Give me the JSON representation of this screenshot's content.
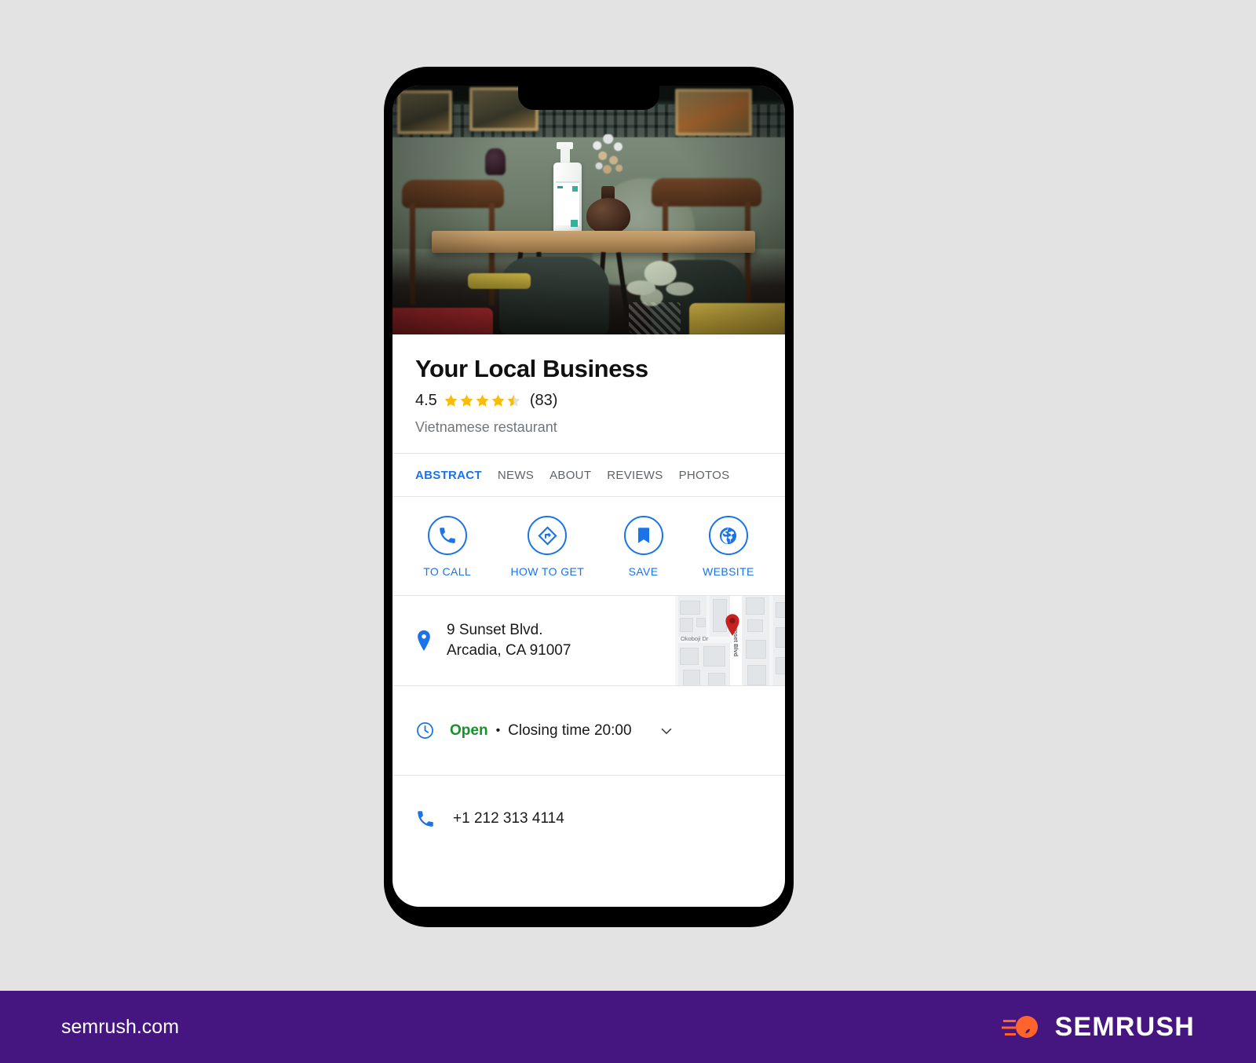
{
  "business": {
    "name": "Your Local Business",
    "rating_value": "4.5",
    "review_count": "(83)",
    "category": "Vietnamese restaurant",
    "stars_filled": 4,
    "stars_half": 1,
    "stars_total": 5,
    "star_color": "#fbbc04",
    "star_empty_color": "#e0e0e0"
  },
  "tabs": [
    {
      "label": "ABSTRACT",
      "active": true
    },
    {
      "label": "NEWS",
      "active": false
    },
    {
      "label": "ABOUT",
      "active": false
    },
    {
      "label": "REVIEWS",
      "active": false
    },
    {
      "label": "PHOTOS",
      "active": false
    }
  ],
  "actions": [
    {
      "label": "TO CALL",
      "icon": "phone-icon"
    },
    {
      "label": "HOW TO GET",
      "icon": "directions-icon"
    },
    {
      "label": "SAVE",
      "icon": "bookmark-icon"
    },
    {
      "label": "WEBSITE",
      "icon": "globe-icon"
    }
  ],
  "address": {
    "line1": "9 Sunset Blvd.",
    "line2": "Arcadia, CA 91007",
    "icon": "map-pin-icon",
    "map": {
      "street_label_1": "Okoboji Dr",
      "street_label_2": "Sunset Blvd",
      "pin_color": "#c5221f"
    }
  },
  "hours": {
    "icon": "clock-icon",
    "status": "Open",
    "separator": "•",
    "detail": "Closing time 20:00",
    "chevron": "chevron-down-icon",
    "status_color": "#17912a"
  },
  "phone": {
    "icon": "phone-icon",
    "number": "+1 212 313 4114"
  },
  "footer": {
    "url": "semrush.com",
    "brand": "SEMRUSH",
    "background": "#45167f",
    "logo_color": "#ff642d"
  },
  "theme": {
    "accent_blue": "#1a73e8",
    "page_background": "#e3e3e3",
    "card_background": "#ffffff",
    "muted_text": "#70757a"
  }
}
